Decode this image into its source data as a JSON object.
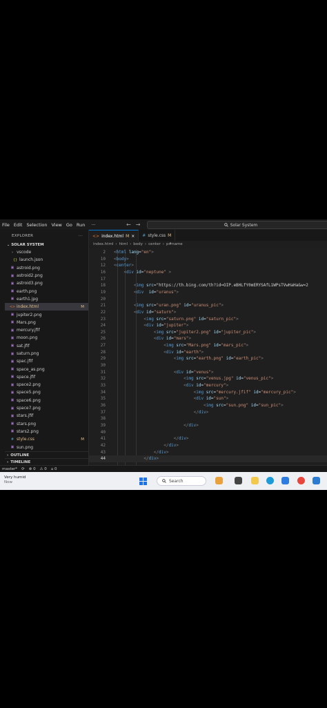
{
  "menubar": {
    "items": [
      "File",
      "Edit",
      "Selection",
      "View",
      "Go",
      "Run"
    ],
    "more": "···",
    "back": "←",
    "forward": "→",
    "search": "Solar System"
  },
  "explorer": {
    "title": "EXPLORER",
    "more": "···",
    "section": "SOLAR SYSTEM",
    "items": [
      {
        "label": "vscode",
        "kind": "folder"
      },
      {
        "label": "launch.json",
        "kind": "json"
      },
      {
        "label": "astroid.png",
        "kind": "image"
      },
      {
        "label": "astroid2.png",
        "kind": "image"
      },
      {
        "label": "astroid3.png",
        "kind": "image"
      },
      {
        "label": "earth.png",
        "kind": "image"
      },
      {
        "label": "earth1.jpg",
        "kind": "image"
      },
      {
        "label": "index.html",
        "kind": "html",
        "status": "M",
        "active": true
      },
      {
        "label": "jupiter2.png",
        "kind": "image"
      },
      {
        "label": "Mars.png",
        "kind": "image"
      },
      {
        "label": "mercury.jfif",
        "kind": "image"
      },
      {
        "label": "moon.png",
        "kind": "image"
      },
      {
        "label": "sat.jfif",
        "kind": "image"
      },
      {
        "label": "saturn.png",
        "kind": "image"
      },
      {
        "label": "spac.jfif",
        "kind": "image"
      },
      {
        "label": "space_as.png",
        "kind": "image"
      },
      {
        "label": "space.jfif",
        "kind": "image"
      },
      {
        "label": "space2.png",
        "kind": "image"
      },
      {
        "label": "space5.png",
        "kind": "image"
      },
      {
        "label": "space6.png",
        "kind": "image"
      },
      {
        "label": "space7.png",
        "kind": "image"
      },
      {
        "label": "stars.jfif",
        "kind": "image"
      },
      {
        "label": "stars.png",
        "kind": "image"
      },
      {
        "label": "stars2.png",
        "kind": "image"
      },
      {
        "label": "style.css",
        "kind": "css",
        "status": "M"
      },
      {
        "label": "sun.png",
        "kind": "image"
      }
    ],
    "outline": "OUTLINE",
    "timeline": "TIMELINE"
  },
  "tabs": [
    {
      "label": "index.html",
      "status": "M",
      "close": "×",
      "active": true
    },
    {
      "label": "style.css",
      "status": "M",
      "active": false
    }
  ],
  "breadcrumb": [
    "index.html",
    "html",
    "body",
    "center",
    "p#name"
  ],
  "editor": {
    "lines": [
      {
        "n": "2",
        "code": "<html lang=\"en\">"
      },
      {
        "n": "10",
        "code": "<body>"
      },
      {
        "n": "12",
        "code": "<center>"
      },
      {
        "n": "16",
        "code": "    <div id=\"neptune\" >"
      },
      {
        "n": "17",
        "code": ""
      },
      {
        "n": "18",
        "code": "        <img src=\"https://th.bing.com/th?id=OIP.eBHLfY0mERYSAfL1WPsTVwHaHa&w=2"
      },
      {
        "n": "19",
        "code": "        <div  id=\"uranus\">"
      },
      {
        "n": "20",
        "code": ""
      },
      {
        "n": "21",
        "code": "        <img src=\"uran.png\" id=\"uranus_pic\">"
      },
      {
        "n": "22",
        "code": "        <div id=\"saturn\">"
      },
      {
        "n": "23",
        "code": "            <img src=\"saturn.png\" id=\"saturn_pic\">"
      },
      {
        "n": "24",
        "code": "            <div id=\"jupiter\">"
      },
      {
        "n": "25",
        "code": "                <img src=\"jupiter2.png\" id=\"jupiter_pic\">"
      },
      {
        "n": "26",
        "code": "                <div id=\"mars\">"
      },
      {
        "n": "27",
        "code": "                    <img src=\"Mars.png\" id=\"mars_pic\">"
      },
      {
        "n": "28",
        "code": "                    <div id=\"earth\">"
      },
      {
        "n": "29",
        "code": "                        <img src=\"earth.png\" id=\"earth_pic\">"
      },
      {
        "n": "30",
        "code": ""
      },
      {
        "n": "31",
        "code": "                        <div id=\"venus\">"
      },
      {
        "n": "32",
        "code": "                            <img src=\"venus.jpg\" id=\"venus_pic\">"
      },
      {
        "n": "33",
        "code": "                            <div id=\"mercury\">"
      },
      {
        "n": "34",
        "code": "                                <img src=\"mercury.jfif\" id=\"mercury_pic\">"
      },
      {
        "n": "35",
        "code": "                                <div id=\"sun\">"
      },
      {
        "n": "36",
        "code": "                                    <img src=\"sun.png\" id=\"sun_pic\">"
      },
      {
        "n": "37",
        "code": "                                </div>"
      },
      {
        "n": "38",
        "code": ""
      },
      {
        "n": "39",
        "code": "                            </div>"
      },
      {
        "n": "40",
        "code": ""
      },
      {
        "n": "41",
        "code": "                        </div>"
      },
      {
        "n": "42",
        "code": "                    </div>"
      },
      {
        "n": "43",
        "code": "                </div>"
      },
      {
        "n": "44",
        "code": "            </div>"
      }
    ],
    "current_line": "44"
  },
  "statusbar": {
    "branch": "master*",
    "sync": "⟳",
    "errors": "⊗ 0",
    "warnings": "⚠ 0",
    "ports": "⌂ 0"
  },
  "taskbar": {
    "weather_title": "Very humid",
    "weather_sub": "Now",
    "search_placeholder": "Search",
    "accent": "#1a73e8"
  }
}
